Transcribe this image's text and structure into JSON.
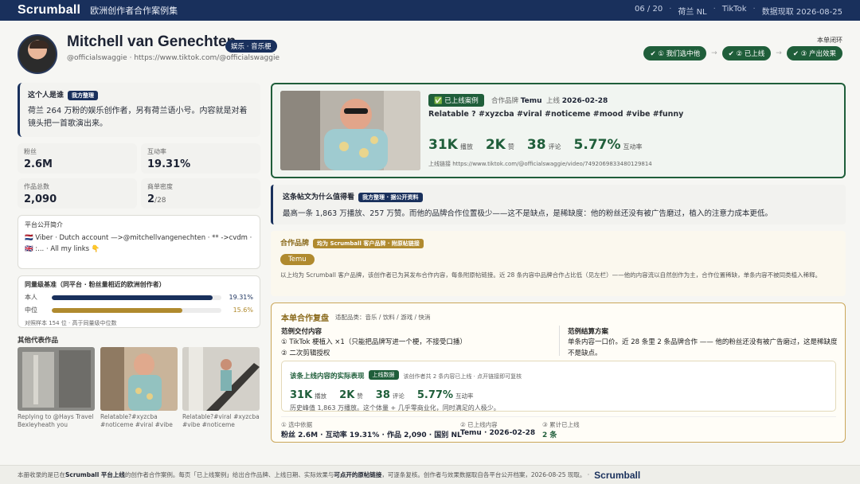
{
  "topbar": {
    "logo": "Scrumball",
    "subtitle": "欧洲创作者合作案例集",
    "page": "06 / 20",
    "region": "荷兰 NL",
    "platform": "TikTok",
    "data_date": "数据现取 2026-08-25"
  },
  "profile": {
    "name": "Mitchell van Genechten",
    "category_tag": "娱乐 · 音乐梗",
    "handle": "@officialswaggie",
    "url": "https://www.tiktok.com/@officialswaggie"
  },
  "loop": {
    "label": "本单闭环",
    "steps": [
      "✔ ① 我们选中他",
      "✔ ② 已上线",
      "✔ ③ 产出效果"
    ],
    "arrow": "→"
  },
  "who": {
    "title": "这个人是谁",
    "tag": "我方整理",
    "desc": "荷兰 264 万粉的娱乐创作者，另有荷兰语小号。内容就是对着镜头把一首歌演出来。"
  },
  "stats": [
    {
      "label": "粉丝",
      "value": "2.6M",
      "suffix": ""
    },
    {
      "label": "互动率",
      "value": "19.31%",
      "suffix": ""
    },
    {
      "label": "作品总数",
      "value": "2,090",
      "suffix": ""
    },
    {
      "label": "商单密度",
      "value": "2",
      "suffix": "/28"
    }
  ],
  "bio": {
    "title": "平台公开简介",
    "line1": "🇳🇱 Viber · Dutch account —>@mitchellvangenechten · ** ->cvdm ·",
    "line2": "🇬🇧 :... · All my links 👇"
  },
  "benchmark": {
    "title": "同量级基准（同平台 · 粉丝量相近的欧洲创作者）",
    "rows": [
      {
        "label": "本人",
        "value": "19.31%",
        "fraction": 0.95,
        "color": "#19305c"
      },
      {
        "label": "中位",
        "value": "15.6%",
        "fraction": 0.77,
        "color": "#b08a2e"
      }
    ],
    "note": "对照样本 154 位 · 高于同量级中位数"
  },
  "others": {
    "title": "其他代表作品",
    "items": [
      {
        "caption1": "Replying to @Hays Travel",
        "caption2": "Bexleyheath you"
      },
      {
        "caption1": "Relatable?#xyzcba",
        "caption2": "#noticeme #viral #vibe"
      },
      {
        "caption1": "Relatable?#viral #xyzcba",
        "caption2": "#vibe #noticeme"
      }
    ]
  },
  "hero": {
    "tag": "✅ 已上线案例",
    "brand_label": "合作品牌",
    "brand": "Temu",
    "live_label": "上线",
    "live_date": "2026-02-28",
    "caption": "Relatable ? #xyzcba #viral #noticeme #mood #vibe #funny",
    "metrics": [
      {
        "value": "31K",
        "unit": "播放"
      },
      {
        "value": "2K",
        "unit": "赞"
      },
      {
        "value": "38",
        "unit": "评论"
      },
      {
        "value": "5.77%",
        "unit": "互动率"
      }
    ],
    "url": "上线链接 https://www.tiktok.com/@officialswaggie/video/7492069833480129814"
  },
  "why": {
    "title": "这条帖文为什么值得看",
    "tag": "我方整理 · 据公开资料",
    "desc": "最高一条 1,863 万播放、257 万赞。而他的品牌合作位置极少——这不是缺点，是稀缺度：他的粉丝还没有被广告磨过，植入的注意力成本更低。"
  },
  "brand_card": {
    "title": "合作品牌",
    "tag": "均为 Scrumball 客户品牌 · 附原帖链接",
    "chip": "Temu",
    "desc": "以上均为 Scrumball 客户品牌，该创作者已为其发布合作内容，每条附原帖链接。近 28 条内容中品牌合作占比低（见左栏）——他的内容流以自然创作为主，合作位置稀缺，单条内容不被同类植入稀释。"
  },
  "review": {
    "title": "本单合作复盘",
    "categories": "适配品类：音乐 / 饮料 / 游戏 / 快消",
    "deliver_title": "范例交付内容",
    "deliver_1": "① TikTok 梗植入 ×1（只能把品牌写进一个梗，不接受口播）",
    "deliver_2": "② 二次剪辑授权",
    "settle_title": "范例结算方案",
    "settle_desc": "单条内容一口价。近 28 条里 2 条品牌合作 —— 他的粉丝还没有被广告磨过，这是稀缺度不是缺点。",
    "inner_title": "该条上线内容的实际表现",
    "inner_tag": "上线数据",
    "inner_note": "该创作者共 2 条内容已上线 · 点开链接即可复核",
    "inner_metrics": [
      {
        "value": "31K",
        "unit": "播放"
      },
      {
        "value": "2K",
        "unit": "赞"
      },
      {
        "value": "38",
        "unit": "评论"
      },
      {
        "value": "5.77%",
        "unit": "互动率"
      }
    ],
    "inner_desc": "历史峰值 1,863 万播放。这个体量 + 几乎零商业化，同时满足的人极少。",
    "foot": [
      {
        "label": "① 选中依据",
        "value": "粉丝 2.6M · 互动率 19.31% · 作品 2,090 · 国别 NL"
      },
      {
        "label": "② 已上线内容",
        "value": "Temu · 2026-02-28"
      },
      {
        "label": "③ 累计已上线",
        "value": "2 条"
      }
    ]
  },
  "footer": {
    "text_a": "本册收录的是已在 ",
    "text_b": "Scrumball 平台上线",
    "text_c": "的创作者合作案例。每页「已上线案例」给出合作品牌、上线日期、实际效果与",
    "text_d": "可点开的原帖链接",
    "text_e": "，可逐条复核。创作者与效果数据取自各平台公开档案，2026-08-25 现取。 ·",
    "logo": "Scrumball"
  }
}
